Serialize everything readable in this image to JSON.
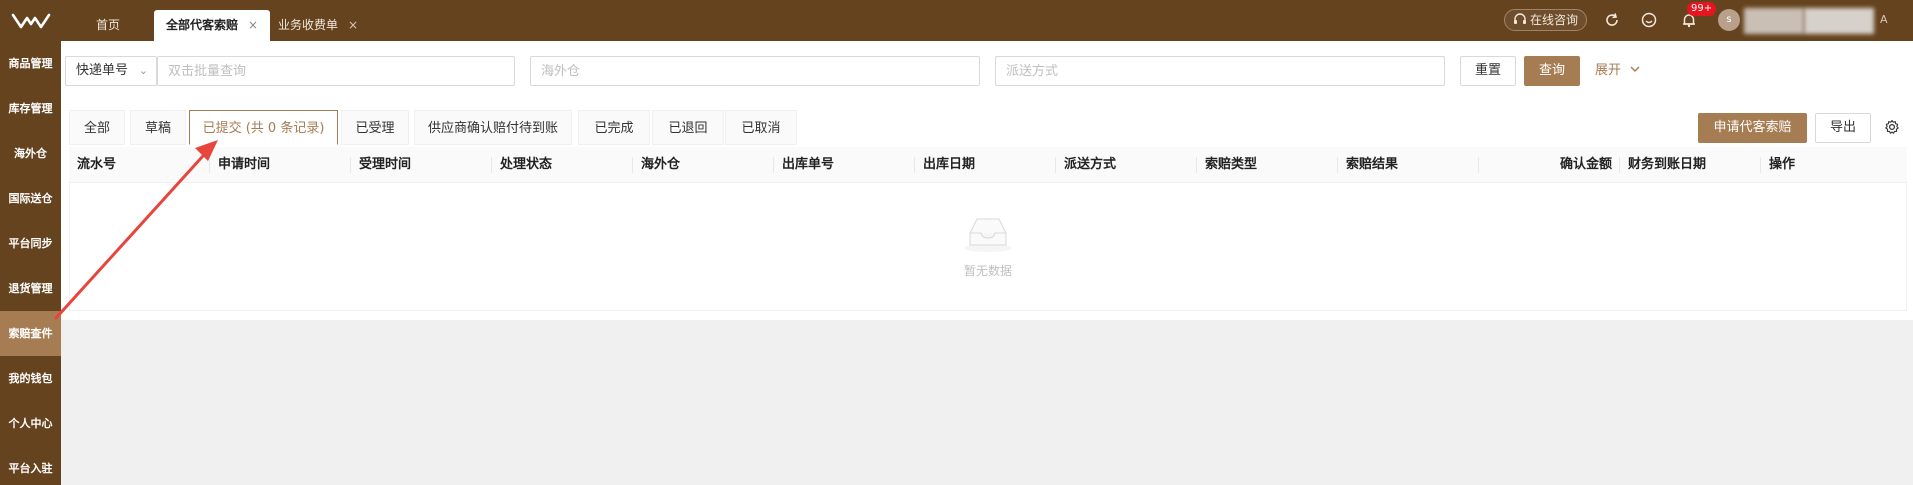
{
  "tabs": [
    {
      "label": "首页"
    },
    {
      "label": "全部代客索赔",
      "close": "×"
    },
    {
      "label": "业务收费单",
      "close": "×"
    }
  ],
  "header": {
    "consult_label": "在线咨询",
    "notification_count": "99+",
    "avatar_initial": "s",
    "trail_letter": "A"
  },
  "sidebar": {
    "items": [
      {
        "label": "商品管理"
      },
      {
        "label": "库存管理"
      },
      {
        "label": "海外仓"
      },
      {
        "label": "国际送仓"
      },
      {
        "label": "平台同步"
      },
      {
        "label": "退货管理"
      },
      {
        "label": "索赔查件"
      },
      {
        "label": "我的钱包"
      },
      {
        "label": "个人中心"
      },
      {
        "label": "平台入驻"
      }
    ]
  },
  "filters": {
    "select_value": "快递单号",
    "batch_placeholder": "双击批量查询",
    "warehouse_placeholder": "海外仓",
    "delivery_placeholder": "派送方式",
    "reset_label": "重置",
    "search_label": "查询",
    "expand_label": "展开"
  },
  "subtabs": [
    {
      "label": "全部"
    },
    {
      "label": "草稿"
    },
    {
      "label": "已提交 (共 0 条记录)"
    },
    {
      "label": "已受理"
    },
    {
      "label": "供应商确认赔付待到账"
    },
    {
      "label": "已完成"
    },
    {
      "label": "已退回"
    },
    {
      "label": "已取消"
    }
  ],
  "actions": {
    "apply_label": "申请代客索赔",
    "export_label": "导出"
  },
  "table": {
    "columns": [
      "流水号",
      "申请时间",
      "受理时间",
      "处理状态",
      "海外仓",
      "出库单号",
      "出库日期",
      "派送方式",
      "索赔类型",
      "索赔结果",
      "确认金额",
      "财务到账日期",
      "操作"
    ],
    "empty_text": "暂无数据"
  },
  "colors": {
    "brand_dark": "#65431f",
    "accent": "#a67c52",
    "annotation_red": "#e8453c"
  }
}
